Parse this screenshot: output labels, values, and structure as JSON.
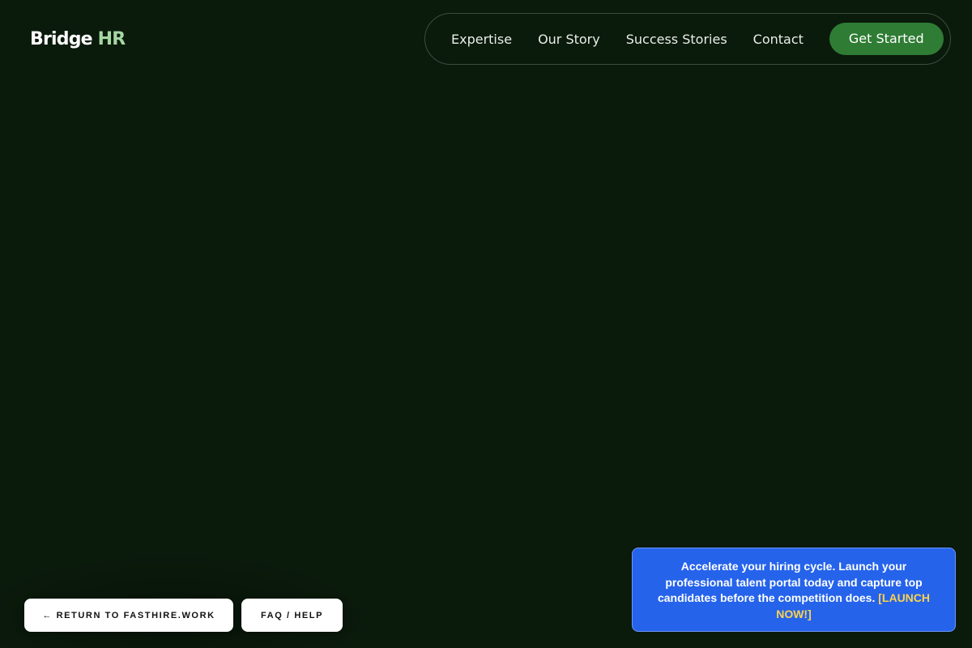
{
  "header": {
    "logo_main": "Bridge",
    "logo_accent": "HR",
    "nav": [
      {
        "label": "Expertise"
      },
      {
        "label": "Our Story"
      },
      {
        "label": "Success Stories"
      },
      {
        "label": "Contact"
      }
    ],
    "cta_label": "Get Started"
  },
  "footer_buttons": {
    "return_label": "← RETURN TO FASTHIRE.WORK",
    "faq_label": "FAQ / HELP"
  },
  "promo": {
    "message": "Accelerate your hiring cycle. Launch your professional talent portal today and capture top candidates before the competition does.",
    "link_label": "[LAUNCH NOW!]"
  },
  "colors": {
    "background": "#0a1a0b",
    "logo_accent": "#a6d7a3",
    "cta": "#2f7c34",
    "promo_bg": "#2563eb",
    "promo_link": "#fcd34d"
  }
}
